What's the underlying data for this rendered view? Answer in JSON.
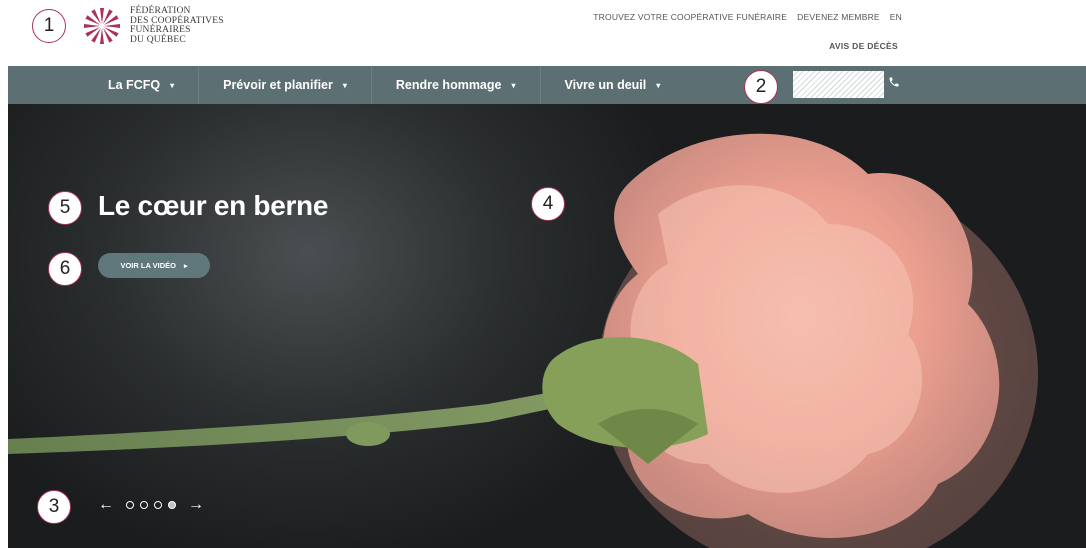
{
  "header": {
    "logo_lines": [
      "FÉDÉRATION",
      "DES COOPÉRATIVES",
      "FUNÉRAIRES",
      "DU QUÉBEC"
    ],
    "top_links": [
      "TROUVEZ VOTRE COOPÉRATIVE FUNÉRAIRE",
      "DEVENEZ MEMBRE",
      "EN"
    ],
    "avis_link": "AVIS DE DÉCÈS"
  },
  "nav": {
    "items": [
      {
        "label": "La FCFQ",
        "caret": "▾"
      },
      {
        "label": "Prévoir et planifier",
        "caret": "▾"
      },
      {
        "label": "Rendre hommage",
        "caret": "▾"
      },
      {
        "label": "Vivre un deuil",
        "caret": "▾"
      }
    ],
    "phone_icon": "phone-icon"
  },
  "hero": {
    "title": "Le cœur en berne",
    "video_button": "VOIR LA VIDÉO",
    "video_button_icon": "▸",
    "prev_arrow": "←",
    "next_arrow": "→",
    "slide_count": 4,
    "active_slide": 4
  },
  "markers": [
    "1",
    "2",
    "3",
    "4",
    "5",
    "6"
  ],
  "colors": {
    "nav_bg": "#5c6f73",
    "button_bg": "#60787c",
    "marker_border": "#a8325a",
    "logo_accent": "#a8325a"
  }
}
